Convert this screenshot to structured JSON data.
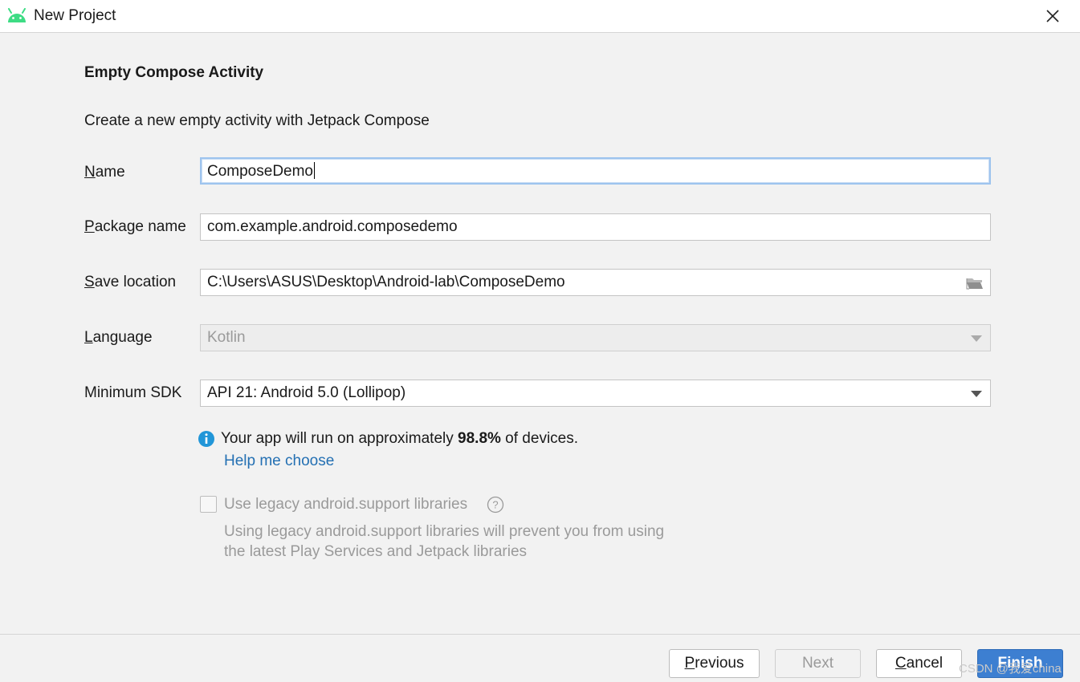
{
  "window": {
    "title": "New Project",
    "close_icon": "close-icon"
  },
  "section": {
    "title": "Empty Compose Activity",
    "description": "Create a new empty activity with Jetpack Compose"
  },
  "fields": {
    "name": {
      "mnemonic": "N",
      "label_rest": "ame",
      "value": "ComposeDemo"
    },
    "package": {
      "mnemonic": "P",
      "label_rest": "ackage name",
      "value": "com.example.android.composedemo"
    },
    "location": {
      "mnemonic": "S",
      "label_rest": "ave location",
      "value": "C:\\Users\\ASUS\\Desktop\\Android-lab\\ComposeDemo",
      "icon": "folder-icon"
    },
    "language": {
      "mnemonic": "L",
      "label_rest": "anguage",
      "value": "Kotlin",
      "enabled": false
    },
    "min_sdk": {
      "label": "Minimum SDK",
      "value": "API 21: Android 5.0 (Lollipop)"
    }
  },
  "sdk_info": {
    "prefix": "Your app will run on approximately ",
    "percent": "98.8%",
    "suffix": " of devices.",
    "help_link": "Help me choose",
    "icon": "info-icon"
  },
  "legacy": {
    "label": "Use legacy android.support libraries",
    "checked": false,
    "enabled": false,
    "hint_line1": "Using legacy android.support libraries will prevent you from using",
    "hint_line2": "the latest Play Services and Jetpack libraries",
    "icon": "help-icon"
  },
  "buttons": {
    "previous": {
      "mnemonic": "P",
      "rest": "revious"
    },
    "next": {
      "label": "Next",
      "enabled": false
    },
    "cancel": {
      "mnemonic": "C",
      "rest": "ancel"
    },
    "finish": {
      "label": "Finish"
    }
  },
  "watermark": "CSDN @我爱china",
  "colors": {
    "accent": "#3d7fd1",
    "link": "#2470b3",
    "focus_border": "#9ec4ee",
    "info_blue": "#2196d8",
    "android_green": "#3ddc84"
  }
}
